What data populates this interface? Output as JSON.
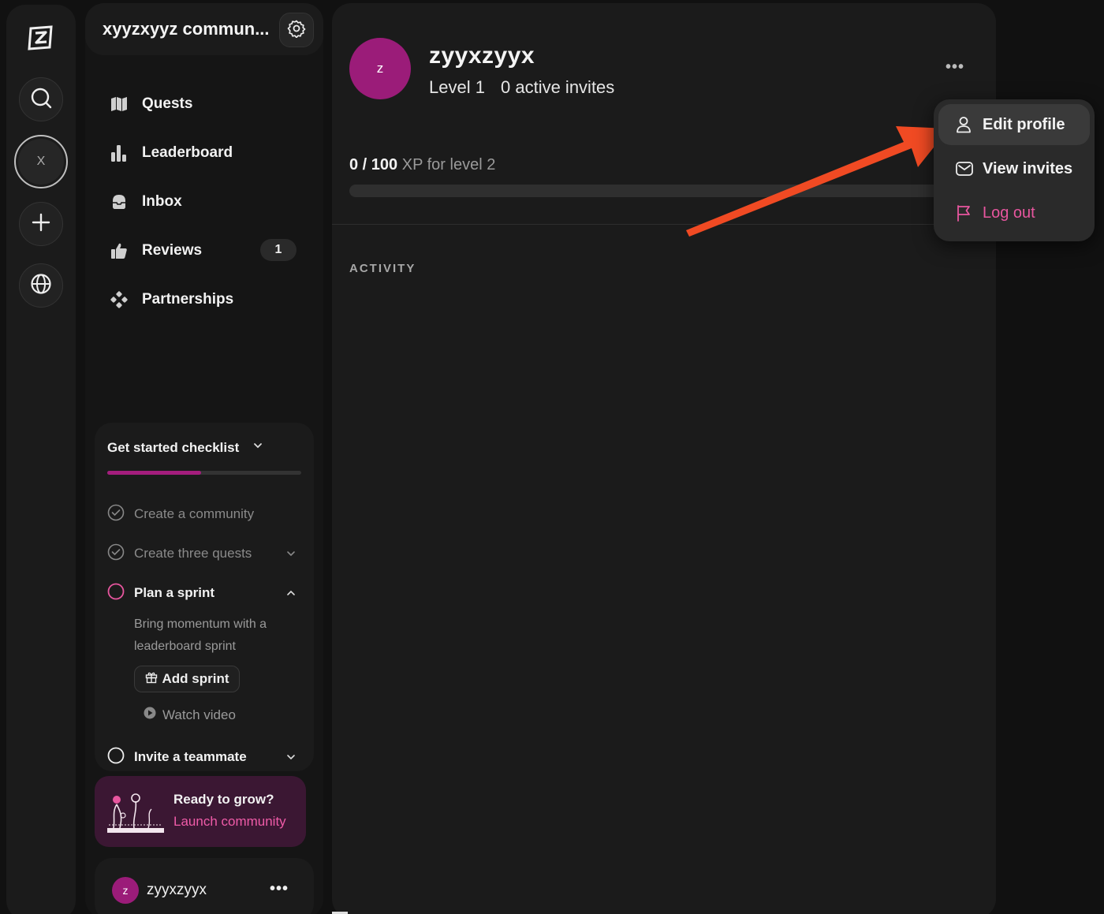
{
  "rail": {
    "logo_icon": "z-logo-icon",
    "search_icon": "search-icon",
    "community_initial": "X",
    "add_icon": "plus-icon",
    "globe_icon": "globe-icon"
  },
  "sidebar": {
    "title": "xyyzxyyz commun...",
    "nav": [
      {
        "label": "Quests",
        "icon": "map-icon"
      },
      {
        "label": "Leaderboard",
        "icon": "bar-chart-icon"
      },
      {
        "label": "Inbox",
        "icon": "inbox-icon"
      },
      {
        "label": "Reviews",
        "icon": "thumbs-up-icon",
        "badge": "1"
      },
      {
        "label": "Partnerships",
        "icon": "partnership-icon"
      }
    ]
  },
  "checklist": {
    "title": "Get started checklist",
    "progress_fraction": 0.5,
    "items": [
      {
        "label": "Create a community",
        "done": true
      },
      {
        "label": "Create three quests",
        "done": true
      },
      {
        "label": "Plan a sprint",
        "done": false
      },
      {
        "label": "Invite a teammate",
        "done": false
      }
    ],
    "sprint_description": "Bring momentum with a leaderboard sprint",
    "add_sprint_label": "Add sprint",
    "watch_video_label": "Watch video"
  },
  "grow": {
    "title": "Ready to grow?",
    "link": "Launch community"
  },
  "user": {
    "initial": "z",
    "name": "zyyxzyyx",
    "more": "•••"
  },
  "profile": {
    "initial": "z",
    "name": "zyyxzyyx",
    "level": "Level 1",
    "invites": "0 active invites",
    "more": "•••",
    "xp_current": "0 / 100",
    "xp_suffix": "XP for level 2",
    "xp_fraction": 0.0,
    "activity_label": "ACTIVITY"
  },
  "menu": {
    "items": [
      {
        "label": "Edit profile",
        "icon": "user-icon"
      },
      {
        "label": "View invites",
        "icon": "mail-icon"
      },
      {
        "label": "Log out",
        "icon": "flag-icon"
      }
    ]
  },
  "colors": {
    "accent": "#9b1c79",
    "logout": "#e8569f",
    "arrow": "#f04a23"
  }
}
